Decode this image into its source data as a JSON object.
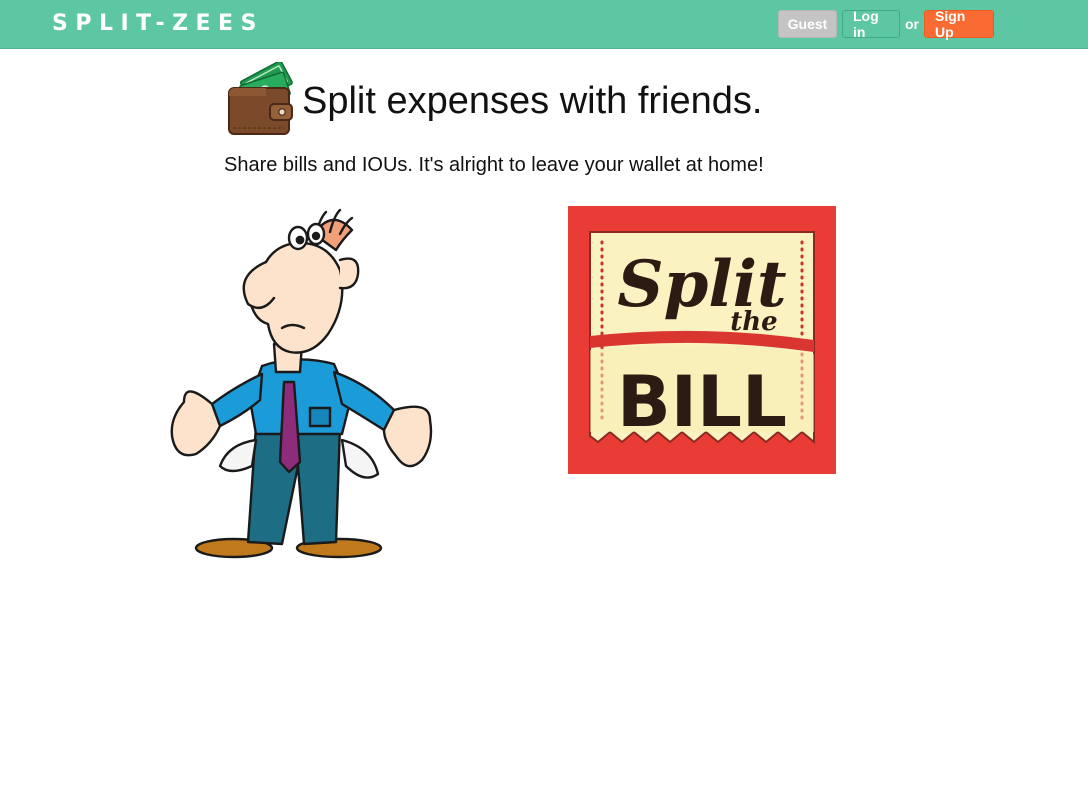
{
  "navbar": {
    "brand": "SPLIT-ZEES",
    "guest_label": "Guest",
    "login_label": "Log in",
    "or_text": "or",
    "signup_label": "Sign Up",
    "colors": {
      "bar": "#5dc6a3",
      "guest": "#c4c4c4",
      "signup": "#fa6b33"
    }
  },
  "hero": {
    "title": "Split expenses with friends.",
    "subtitle": "Share bills and IOUs. It's alright to leave your wallet at home!",
    "wallet_icon": "wallet-with-cash-icon"
  },
  "illustrations": {
    "left": "empty-pockets-man-cartoon",
    "right": {
      "word1": "Split",
      "word2": "the",
      "word3": "BILL",
      "colors": {
        "frame": "#e93c35",
        "ticket": "#fbf2c2",
        "text": "#2b1b12"
      }
    }
  }
}
